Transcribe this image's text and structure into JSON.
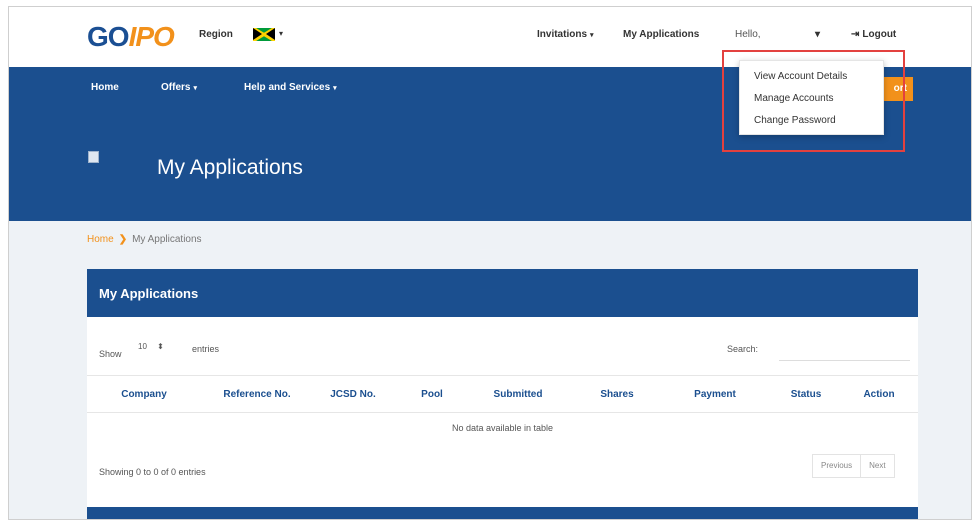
{
  "brand": {
    "logo_go": "GO",
    "logo_ipo": "IPO"
  },
  "topbar": {
    "region_label": "Region",
    "invitations": "Invitations",
    "my_applications": "My Applications",
    "hello": "Hello,",
    "logout": "Logout"
  },
  "nav": {
    "home": "Home",
    "offers": "Offers",
    "help": "Help and Services",
    "button_partial": "ort"
  },
  "hero": {
    "title": "My Applications"
  },
  "breadcrumb": {
    "home": "Home",
    "current": "My Applications"
  },
  "panel": {
    "title": "My Applications",
    "show": "Show",
    "entries_value": "10",
    "entries": "entries",
    "search_label": "Search:",
    "search_value": ""
  },
  "table": {
    "columns": [
      "Company",
      "Reference No.",
      "JCSD No.",
      "Pool",
      "Submitted",
      "Shares",
      "Payment",
      "Status",
      "Action"
    ],
    "empty_text": "No data available in table",
    "info": "Showing 0 to 0 of 0 entries",
    "previous": "Previous",
    "next": "Next"
  },
  "dropdown": {
    "items": [
      "View Account Details",
      "Manage Accounts",
      "Change Password"
    ]
  },
  "colors": {
    "primary": "#1b4f8f",
    "accent": "#f2911b",
    "highlight": "#e3413f"
  },
  "icons": {
    "flag": "jamaica-flag-icon",
    "logout": "logout-icon",
    "caret": "caret-down-icon"
  }
}
